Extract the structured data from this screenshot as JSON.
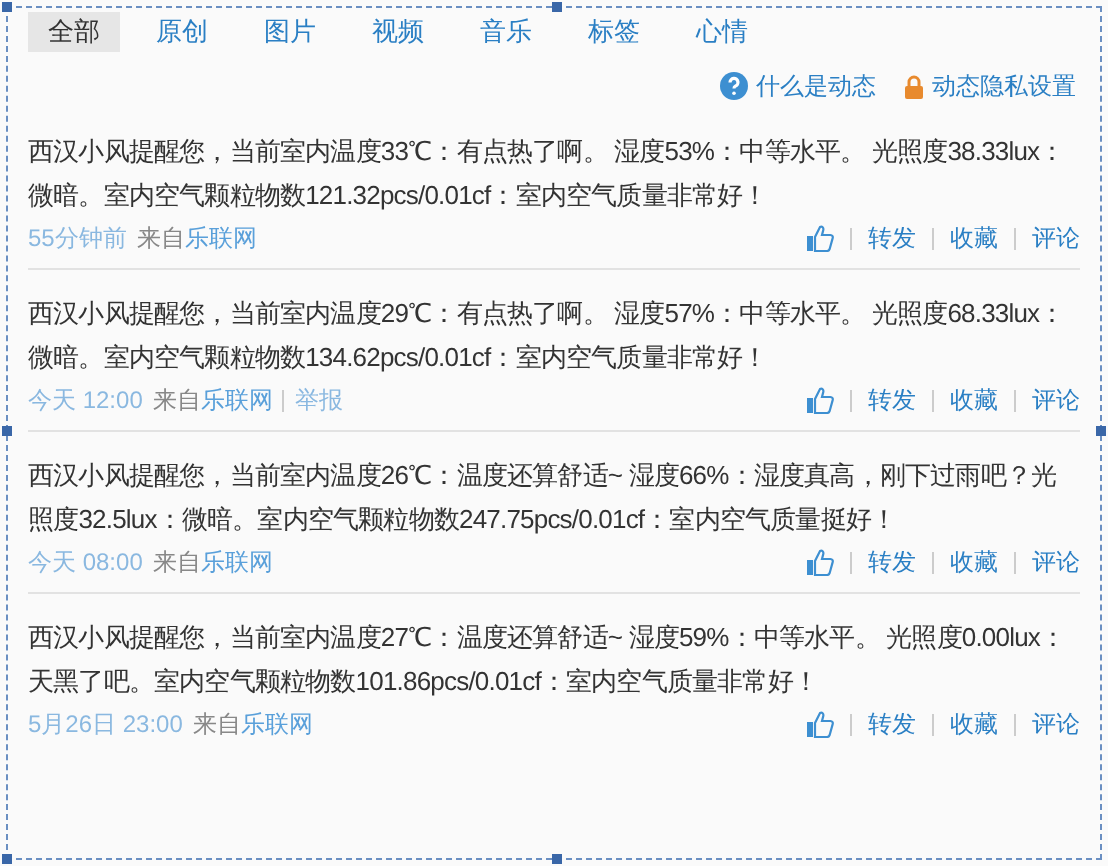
{
  "tabs": [
    {
      "label": "全部",
      "selected": true
    },
    {
      "label": "原创",
      "selected": false
    },
    {
      "label": "图片",
      "selected": false
    },
    {
      "label": "视频",
      "selected": false
    },
    {
      "label": "音乐",
      "selected": false
    },
    {
      "label": "标签",
      "selected": false
    },
    {
      "label": "心情",
      "selected": false
    }
  ],
  "links": [
    {
      "kind": "help",
      "label": "什么是动态"
    },
    {
      "kind": "lock",
      "label": "动态隐私设置"
    }
  ],
  "posts": [
    {
      "text": "西汉小风提醒您，当前室内温度33℃：有点热了啊。 湿度53%：中等水平。 光照度38.33lux：微暗。室内空气颗粒物数121.32pcs/0.01cf：室内空气质量非常好！",
      "time": "55分钟前",
      "from": "来自",
      "source": "乐联网",
      "actions": [
        "转发",
        "收藏",
        "评论"
      ]
    },
    {
      "text": "西汉小风提醒您，当前室内温度29℃：有点热了啊。 湿度57%：中等水平。 光照度68.33lux：微暗。室内空气颗粒物数134.62pcs/0.01cf：室内空气质量非常好！",
      "time": "今天 12:00",
      "from": "来自",
      "source": "乐联网",
      "report": "举报",
      "actions": [
        "转发",
        "收藏",
        "评论"
      ]
    },
    {
      "text": "西汉小风提醒您，当前室内温度26℃：温度还算舒适~ 湿度66%：湿度真高，刚下过雨吧？光照度32.5lux：微暗。室内空气颗粒物数247.75pcs/0.01cf：室内空气质量挺好！",
      "time": "今天 08:00",
      "from": "来自",
      "source": "乐联网",
      "actions": [
        "转发",
        "收藏",
        "评论"
      ]
    },
    {
      "text": "西汉小风提醒您，当前室内温度27℃：温度还算舒适~ 湿度59%：中等水平。 光照度0.00lux：天黑了吧。室内空气颗粒物数101.86pcs/0.01cf：室内空气质量非常好！",
      "time": "5月26日 23:00",
      "from": "来自",
      "source": "乐联网",
      "actions": [
        "转发",
        "收藏",
        "评论"
      ]
    }
  ]
}
